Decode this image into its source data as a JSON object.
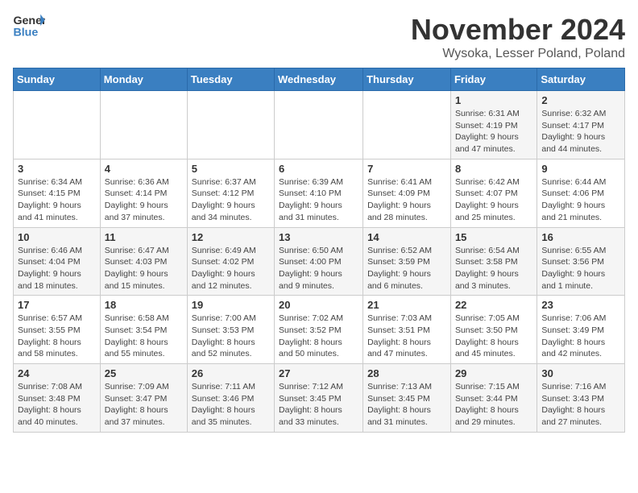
{
  "logo": {
    "general": "General",
    "blue": "Blue"
  },
  "title": "November 2024",
  "location": "Wysoka, Lesser Poland, Poland",
  "days_of_week": [
    "Sunday",
    "Monday",
    "Tuesday",
    "Wednesday",
    "Thursday",
    "Friday",
    "Saturday"
  ],
  "weeks": [
    [
      {
        "day": "",
        "info": ""
      },
      {
        "day": "",
        "info": ""
      },
      {
        "day": "",
        "info": ""
      },
      {
        "day": "",
        "info": ""
      },
      {
        "day": "",
        "info": ""
      },
      {
        "day": "1",
        "info": "Sunrise: 6:31 AM\nSunset: 4:19 PM\nDaylight: 9 hours and 47 minutes."
      },
      {
        "day": "2",
        "info": "Sunrise: 6:32 AM\nSunset: 4:17 PM\nDaylight: 9 hours and 44 minutes."
      }
    ],
    [
      {
        "day": "3",
        "info": "Sunrise: 6:34 AM\nSunset: 4:15 PM\nDaylight: 9 hours and 41 minutes."
      },
      {
        "day": "4",
        "info": "Sunrise: 6:36 AM\nSunset: 4:14 PM\nDaylight: 9 hours and 37 minutes."
      },
      {
        "day": "5",
        "info": "Sunrise: 6:37 AM\nSunset: 4:12 PM\nDaylight: 9 hours and 34 minutes."
      },
      {
        "day": "6",
        "info": "Sunrise: 6:39 AM\nSunset: 4:10 PM\nDaylight: 9 hours and 31 minutes."
      },
      {
        "day": "7",
        "info": "Sunrise: 6:41 AM\nSunset: 4:09 PM\nDaylight: 9 hours and 28 minutes."
      },
      {
        "day": "8",
        "info": "Sunrise: 6:42 AM\nSunset: 4:07 PM\nDaylight: 9 hours and 25 minutes."
      },
      {
        "day": "9",
        "info": "Sunrise: 6:44 AM\nSunset: 4:06 PM\nDaylight: 9 hours and 21 minutes."
      }
    ],
    [
      {
        "day": "10",
        "info": "Sunrise: 6:46 AM\nSunset: 4:04 PM\nDaylight: 9 hours and 18 minutes."
      },
      {
        "day": "11",
        "info": "Sunrise: 6:47 AM\nSunset: 4:03 PM\nDaylight: 9 hours and 15 minutes."
      },
      {
        "day": "12",
        "info": "Sunrise: 6:49 AM\nSunset: 4:02 PM\nDaylight: 9 hours and 12 minutes."
      },
      {
        "day": "13",
        "info": "Sunrise: 6:50 AM\nSunset: 4:00 PM\nDaylight: 9 hours and 9 minutes."
      },
      {
        "day": "14",
        "info": "Sunrise: 6:52 AM\nSunset: 3:59 PM\nDaylight: 9 hours and 6 minutes."
      },
      {
        "day": "15",
        "info": "Sunrise: 6:54 AM\nSunset: 3:58 PM\nDaylight: 9 hours and 3 minutes."
      },
      {
        "day": "16",
        "info": "Sunrise: 6:55 AM\nSunset: 3:56 PM\nDaylight: 9 hours and 1 minute."
      }
    ],
    [
      {
        "day": "17",
        "info": "Sunrise: 6:57 AM\nSunset: 3:55 PM\nDaylight: 8 hours and 58 minutes."
      },
      {
        "day": "18",
        "info": "Sunrise: 6:58 AM\nSunset: 3:54 PM\nDaylight: 8 hours and 55 minutes."
      },
      {
        "day": "19",
        "info": "Sunrise: 7:00 AM\nSunset: 3:53 PM\nDaylight: 8 hours and 52 minutes."
      },
      {
        "day": "20",
        "info": "Sunrise: 7:02 AM\nSunset: 3:52 PM\nDaylight: 8 hours and 50 minutes."
      },
      {
        "day": "21",
        "info": "Sunrise: 7:03 AM\nSunset: 3:51 PM\nDaylight: 8 hours and 47 minutes."
      },
      {
        "day": "22",
        "info": "Sunrise: 7:05 AM\nSunset: 3:50 PM\nDaylight: 8 hours and 45 minutes."
      },
      {
        "day": "23",
        "info": "Sunrise: 7:06 AM\nSunset: 3:49 PM\nDaylight: 8 hours and 42 minutes."
      }
    ],
    [
      {
        "day": "24",
        "info": "Sunrise: 7:08 AM\nSunset: 3:48 PM\nDaylight: 8 hours and 40 minutes."
      },
      {
        "day": "25",
        "info": "Sunrise: 7:09 AM\nSunset: 3:47 PM\nDaylight: 8 hours and 37 minutes."
      },
      {
        "day": "26",
        "info": "Sunrise: 7:11 AM\nSunset: 3:46 PM\nDaylight: 8 hours and 35 minutes."
      },
      {
        "day": "27",
        "info": "Sunrise: 7:12 AM\nSunset: 3:45 PM\nDaylight: 8 hours and 33 minutes."
      },
      {
        "day": "28",
        "info": "Sunrise: 7:13 AM\nSunset: 3:45 PM\nDaylight: 8 hours and 31 minutes."
      },
      {
        "day": "29",
        "info": "Sunrise: 7:15 AM\nSunset: 3:44 PM\nDaylight: 8 hours and 29 minutes."
      },
      {
        "day": "30",
        "info": "Sunrise: 7:16 AM\nSunset: 3:43 PM\nDaylight: 8 hours and 27 minutes."
      }
    ]
  ]
}
